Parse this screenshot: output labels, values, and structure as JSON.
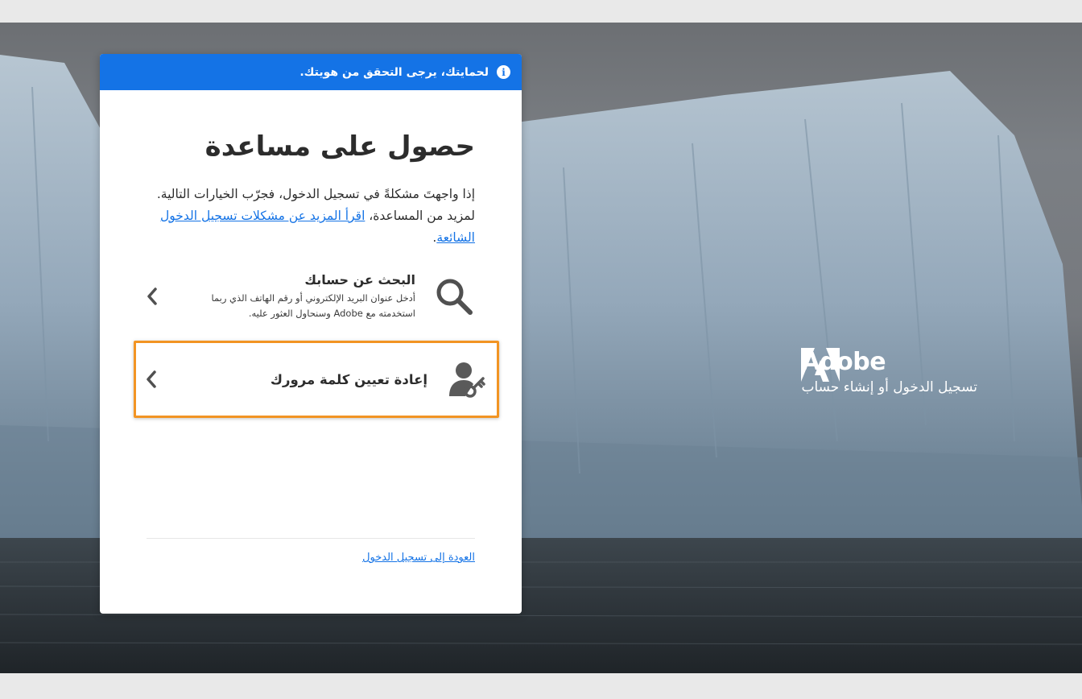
{
  "banner": {
    "text": "لحمايتك، يرجى التحقق من هويتك."
  },
  "page": {
    "title": "حصول على مساعدة",
    "description_prefix": "إذا واجهتَ مشكلةً في تسجيل الدخول، فجرّب الخيارات التالية. لمزيد من المساعدة، ",
    "description_link": "اقرأ المزيد عن مشكلات تسجيل الدخول الشائعة",
    "description_suffix": "."
  },
  "options": {
    "find_account": {
      "title": "البحث عن حسابك",
      "subtitle": "أدخل عنوان البريد الإلكتروني أو رقم الهاتف الذي ربما استخدمته مع Adobe وسنحاول العثور عليه."
    },
    "reset_password": {
      "title": "إعادة تعيين كلمة مرورك"
    }
  },
  "footer": {
    "back_link": "العودة إلى تسجيل الدخول"
  },
  "brand": {
    "name": "Adobe",
    "tagline": "تسجيل الدخول أو إنشاء حساب"
  },
  "colors": {
    "accent": "#1473e6",
    "highlight": "#f29423"
  }
}
